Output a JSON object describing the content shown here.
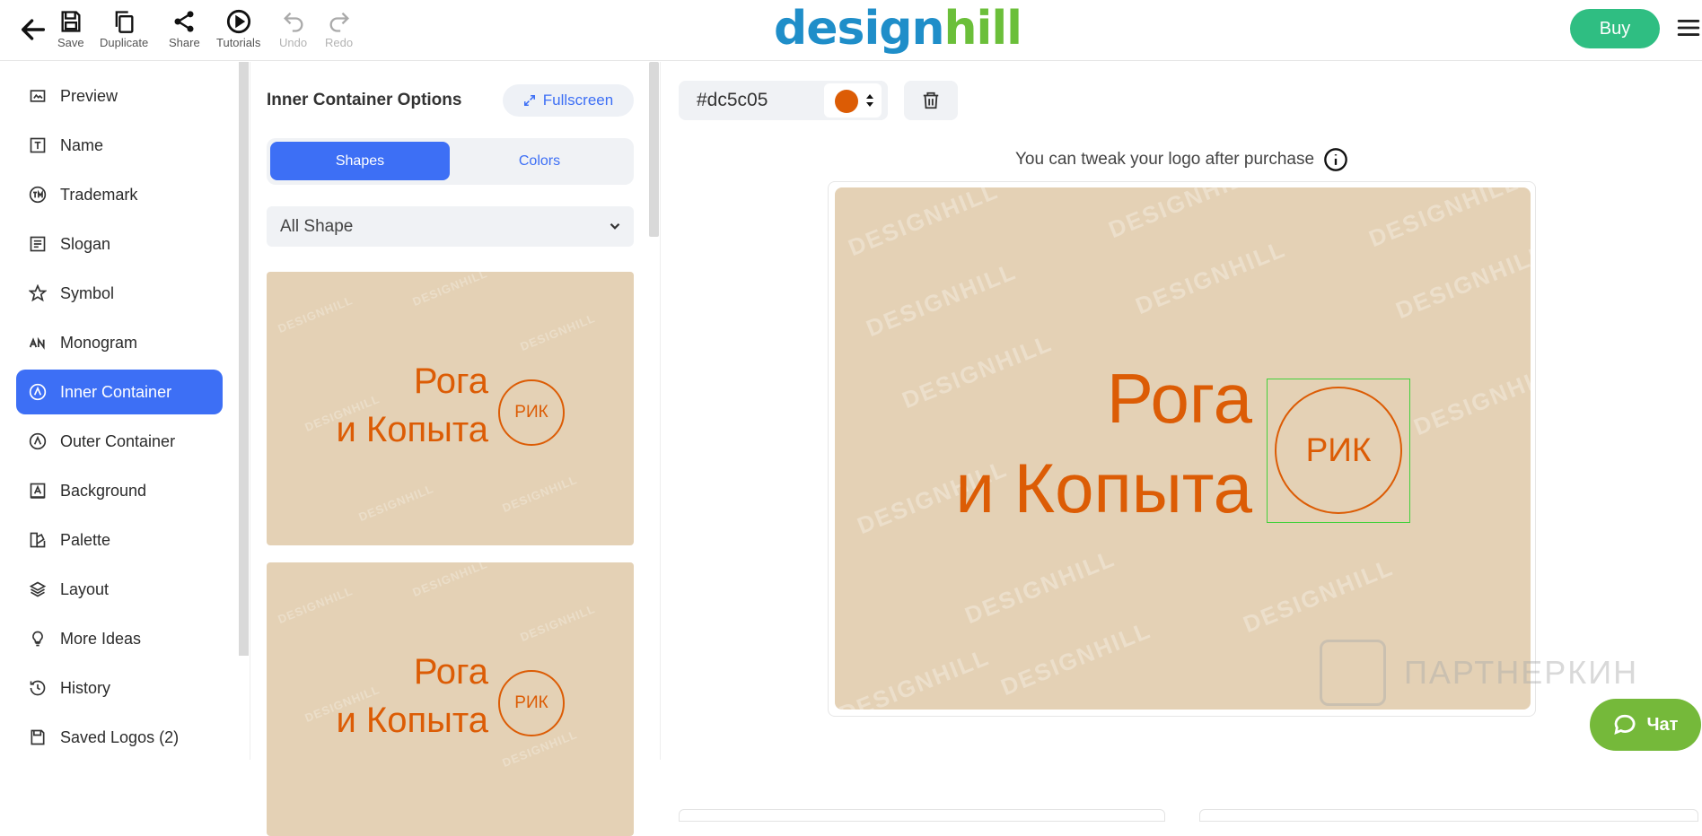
{
  "toolbar": {
    "save": "Save",
    "duplicate": "Duplicate",
    "share": "Share",
    "tutorials": "Tutorials",
    "undo": "Undo",
    "redo": "Redo"
  },
  "brand": {
    "part1": "design",
    "part2": "hill",
    "color1": "#1f8ec9",
    "color2": "#6bbf3a"
  },
  "buy_label": "Buy",
  "sidebar": {
    "items": [
      {
        "label": "Preview",
        "icon": "preview-icon"
      },
      {
        "label": "Name",
        "icon": "name-icon"
      },
      {
        "label": "Trademark",
        "icon": "trademark-icon"
      },
      {
        "label": "Slogan",
        "icon": "slogan-icon"
      },
      {
        "label": "Symbol",
        "icon": "star-icon"
      },
      {
        "label": "Monogram",
        "icon": "monogram-icon"
      },
      {
        "label": "Inner Container",
        "icon": "inner-container-icon",
        "active": true
      },
      {
        "label": "Outer Container",
        "icon": "outer-container-icon"
      },
      {
        "label": "Background",
        "icon": "background-icon"
      },
      {
        "label": "Palette",
        "icon": "palette-icon"
      },
      {
        "label": "Layout",
        "icon": "layers-icon"
      },
      {
        "label": "More Ideas",
        "icon": "lightbulb-icon"
      },
      {
        "label": "History",
        "icon": "history-icon"
      },
      {
        "label": "Saved Logos (2)",
        "icon": "saved-icon"
      }
    ]
  },
  "options": {
    "title": "Inner Container Options",
    "fullscreen": "Fullscreen",
    "tabs": {
      "shapes": "Shapes",
      "colors": "Colors"
    },
    "select_value": "All Shape",
    "thumb_line1": "Рога",
    "thumb_line2": "и Копыта",
    "thumb_mono": "РИК"
  },
  "editor": {
    "color_hex": "#dc5c05",
    "tweak_note": "You can tweak your logo after purchase",
    "logo_line1": "Рога",
    "logo_line2": "и Копыта",
    "monogram": "РИК",
    "bg_color": "#e4d1b5",
    "text_color": "#dc5c05"
  },
  "watermark_text": "DESIGNHILL",
  "partner_watermark": "ПАРТНЕРКИН",
  "chat_label": "Чат"
}
